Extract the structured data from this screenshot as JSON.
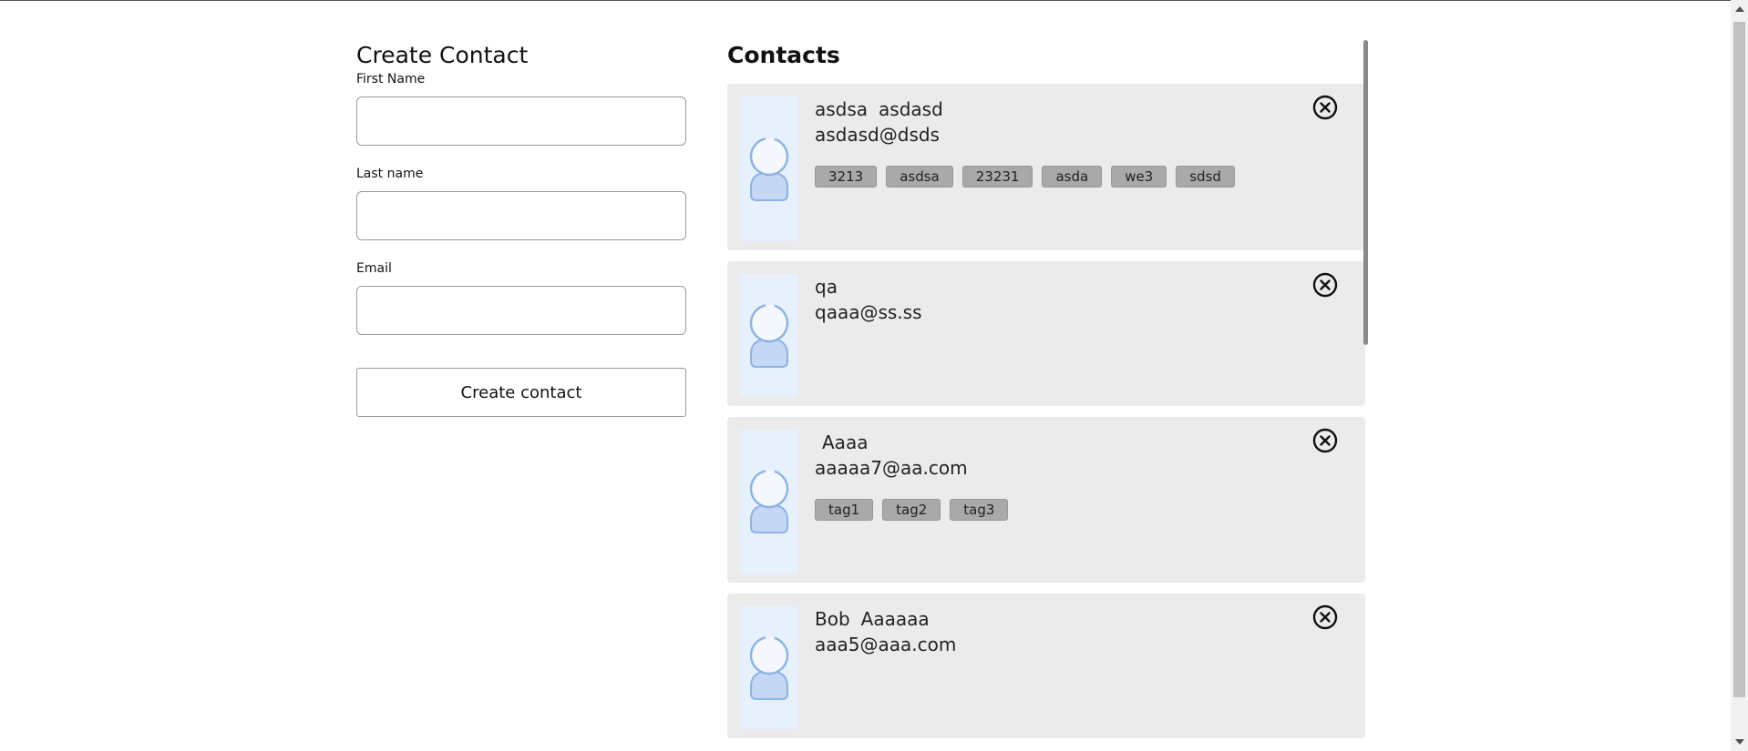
{
  "form": {
    "title": "Create Contact",
    "first_name_label": "First Name",
    "first_name_value": "",
    "last_name_label": "Last name",
    "last_name_value": "",
    "email_label": "Email",
    "email_value": "",
    "submit_label": "Create contact"
  },
  "contacts": {
    "title": "Contacts",
    "items": [
      {
        "first": "asdsa",
        "last": "asdasd",
        "email": "asdasd@dsds",
        "tags": [
          "3213",
          "asdsa",
          "23231",
          "asda",
          "we3",
          "sdsd"
        ]
      },
      {
        "first": "qa",
        "last": "",
        "email": "qaaa@ss.ss",
        "tags": []
      },
      {
        "first": "",
        "last": "Aaaa",
        "email": "aaaaa7@aa.com",
        "tags": [
          "tag1",
          "tag2",
          "tag3"
        ]
      },
      {
        "first": "Bob",
        "last": "Aaaaaa",
        "email": "aaa5@aaa.com",
        "tags": []
      }
    ]
  },
  "icons": {
    "avatar": "person-avatar-icon",
    "remove": "close-circle-icon"
  },
  "colors": {
    "card_bg": "#ebebeb",
    "avatar_bg": "#e6f1fd",
    "tag_bg": "#a9a9a9"
  }
}
